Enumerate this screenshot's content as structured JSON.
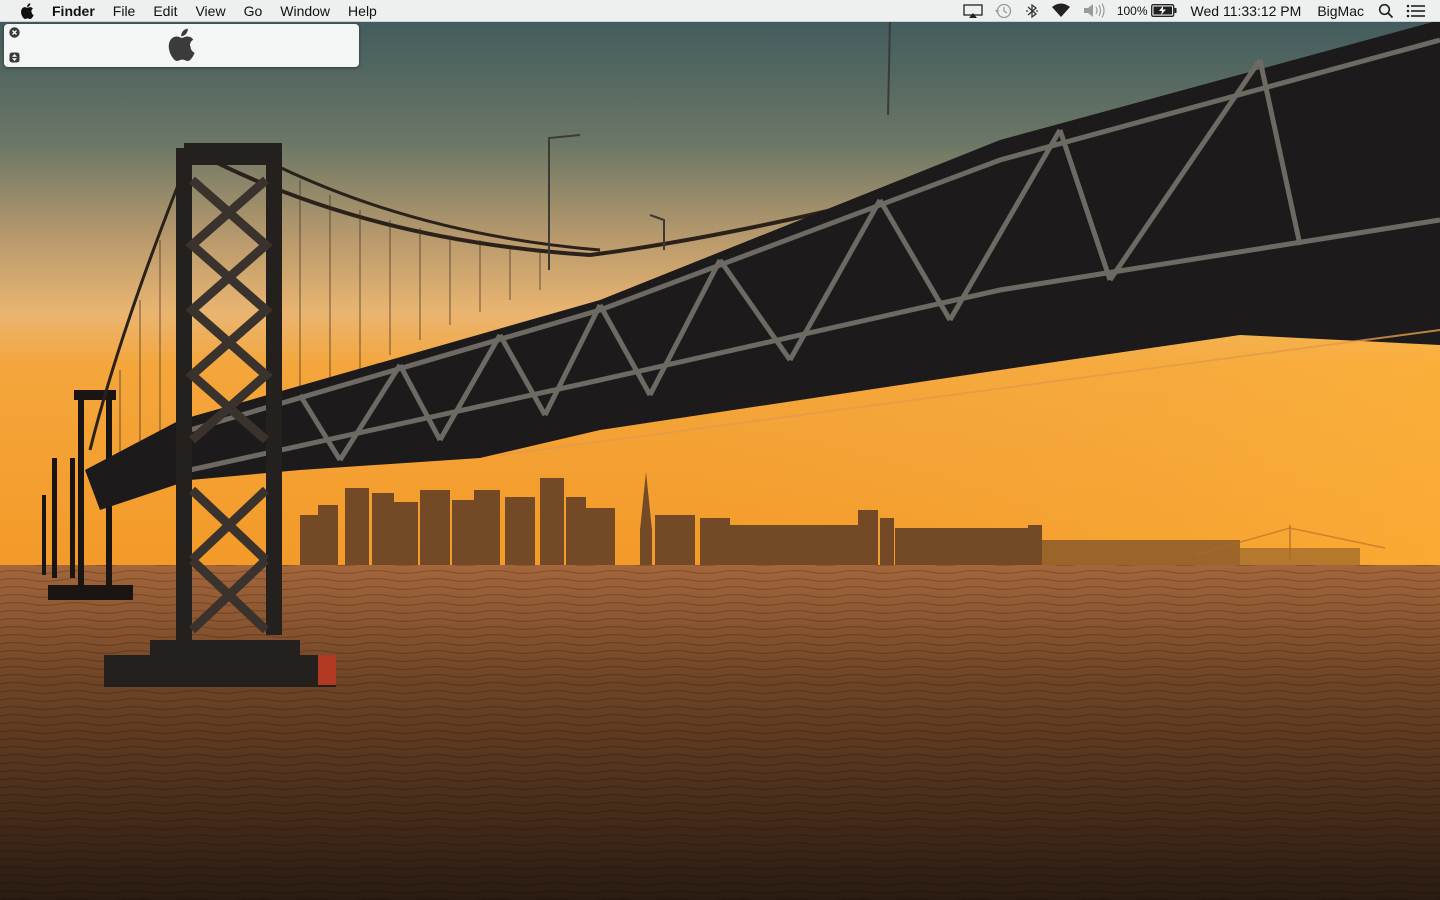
{
  "menubar": {
    "apple_icon": "apple-logo-icon",
    "app_name": "Finder",
    "menus": [
      "File",
      "Edit",
      "View",
      "Go",
      "Window",
      "Help"
    ],
    "status": {
      "airplay_icon": "airplay-icon",
      "time_machine_icon": "time-machine-icon",
      "bluetooth_icon": "bluetooth-icon",
      "wifi_icon": "wifi-icon",
      "volume_icon": "volume-icon",
      "battery_percent": "100%",
      "battery_icon": "battery-charging-icon",
      "clock": "Wed 11:33:12 PM",
      "user_name": "BigMac",
      "spotlight_icon": "search-icon",
      "notification_icon": "notification-center-icon"
    }
  },
  "widget": {
    "close_icon": "close-icon",
    "resize_icon": "resize-icon",
    "logo_icon": "apple-logo-icon"
  },
  "desktop": {
    "wallpaper": "bay-bridge-sunset-wallpaper",
    "colors": {
      "sky_top": "#3f5a5e",
      "sky_horizon": "#f3a640",
      "water": "#5e3a22",
      "bridge": "#1c1c1e"
    }
  }
}
